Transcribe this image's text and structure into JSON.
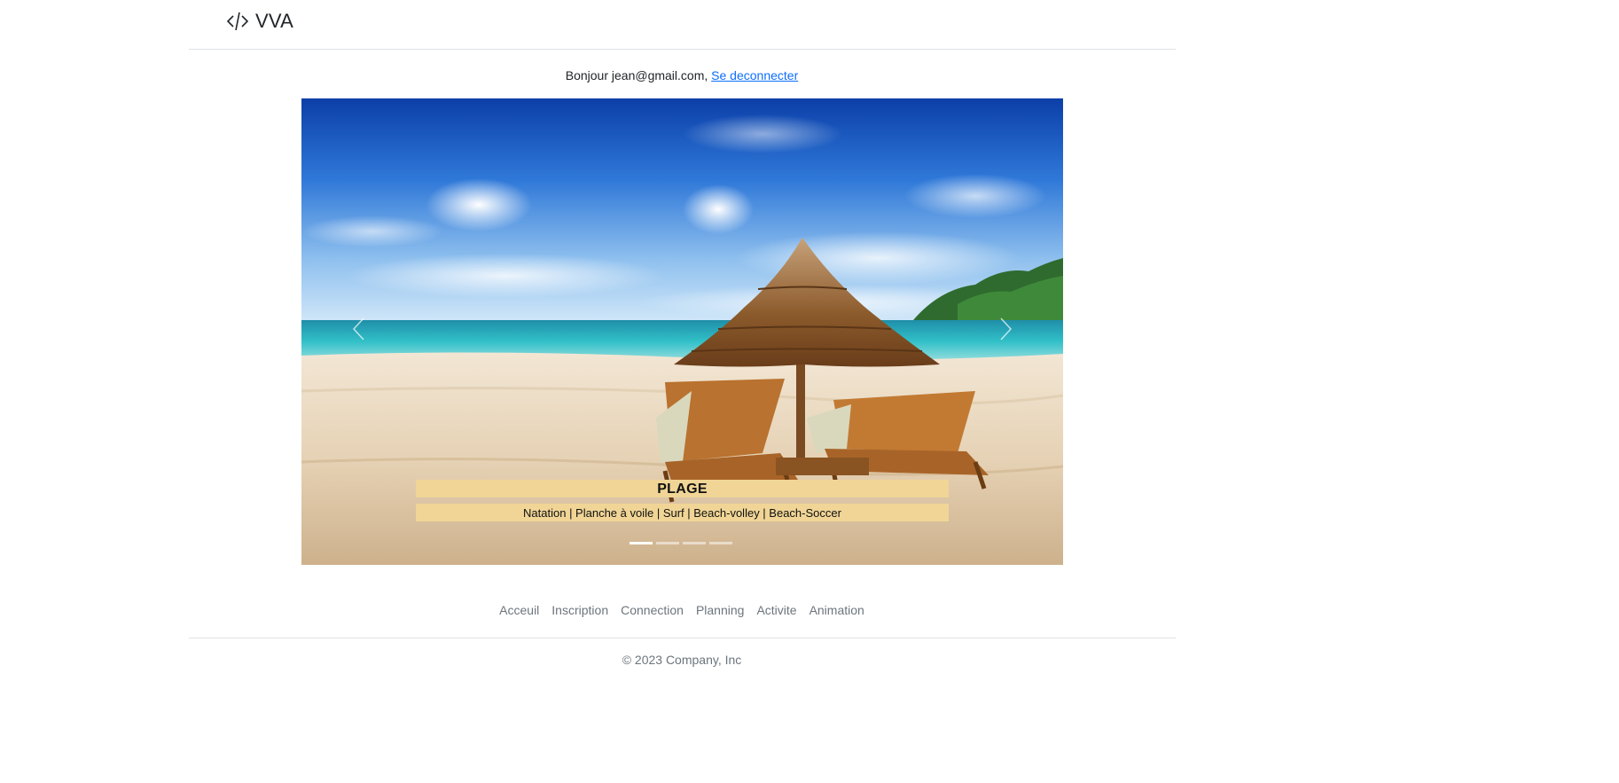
{
  "header": {
    "brand_icon": "code-slash-icon",
    "brand_name": "VVA"
  },
  "greeting": {
    "text": "Bonjour jean@gmail.com, ",
    "logout_link": "Se deconnecter",
    "link_color": "#0d6efd"
  },
  "carousel": {
    "image": "beach-umbrella-lounge-chairs-image",
    "prev_icon": "chevron-left-icon",
    "next_icon": "chevron-right-icon",
    "caption_title": "PLAGE",
    "caption_text": "Natation | Planche à voile | Surf | Beach-volley | Beach-Soccer",
    "caption_bg": "#f0d596",
    "slide_count": 4,
    "active_slide": 1
  },
  "footer": {
    "nav": [
      "Acceuil",
      "Inscription",
      "Connection",
      "Planning",
      "Activite",
      "Animation"
    ],
    "copyright": "© 2023 Company, Inc"
  }
}
